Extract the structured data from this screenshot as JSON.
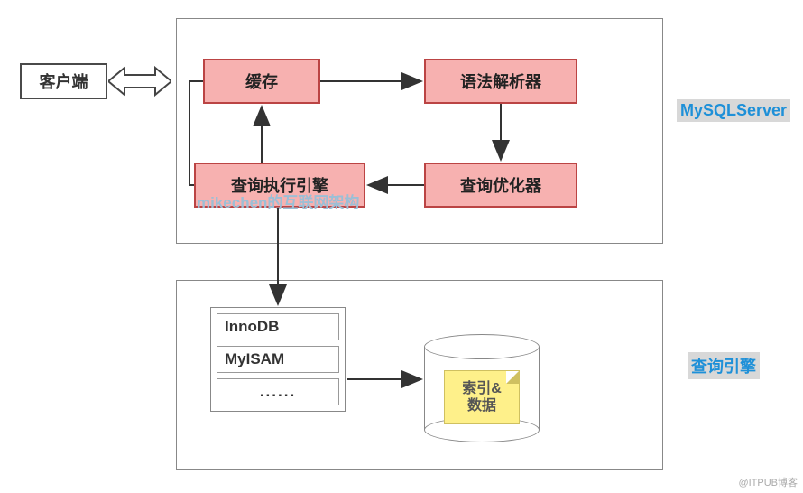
{
  "client": {
    "label": "客户端"
  },
  "server": {
    "label": "MySQLServer",
    "cache": "缓存",
    "parser": "语法解析器",
    "optimizer": "查询优化器",
    "executor": "查询执行引擎"
  },
  "engine": {
    "label": "查询引擎",
    "list": {
      "item0": "InnoDB",
      "item1": "MyISAM",
      "item2": "......"
    },
    "storage": "索引&\n数据"
  },
  "watermark": "mikechen的互联网架构",
  "attribution": "@ITPUB博客"
}
